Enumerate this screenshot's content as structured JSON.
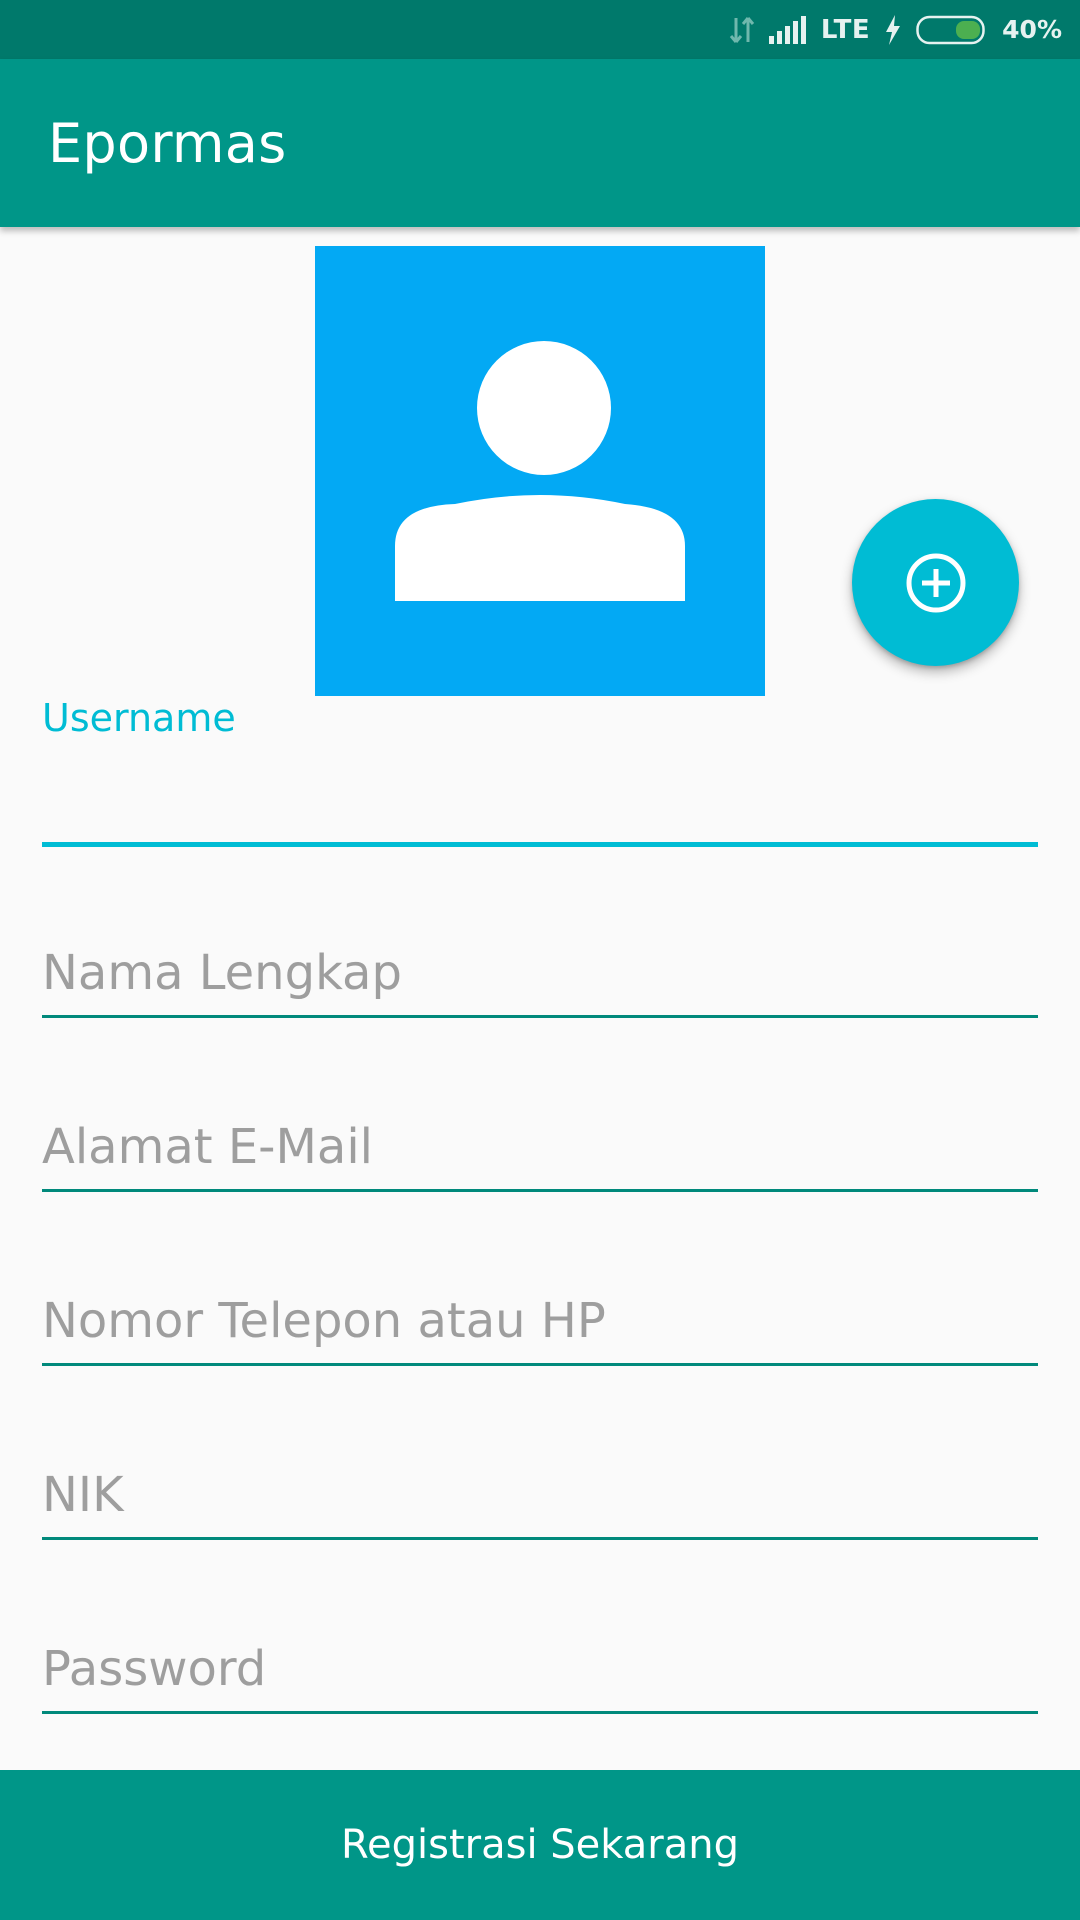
{
  "status_bar": {
    "network": "LTE",
    "battery_percent": "40%",
    "battery_level": 0.4,
    "icons": [
      "data-activity-icon",
      "signal-icon",
      "charging-bolt-icon",
      "battery-icon"
    ]
  },
  "app_bar": {
    "title": "Epormas"
  },
  "avatar": {
    "icon": "person-icon",
    "background_color": "#03a9f4"
  },
  "fab": {
    "icon": "add-circle-icon",
    "color": "#00bcd4"
  },
  "form": {
    "username": {
      "label": "Username",
      "value": ""
    },
    "full_name": {
      "placeholder": "Nama Lengkap"
    },
    "email": {
      "placeholder": "Alamat E-Mail"
    },
    "phone": {
      "placeholder": "Nomor Telepon atau HP"
    },
    "nik": {
      "placeholder": "NIK"
    },
    "password": {
      "placeholder": "Password"
    }
  },
  "register_button": {
    "label": "Registrasi Sekarang"
  },
  "colors": {
    "status_bar": "#00796b",
    "primary": "#009688",
    "accent": "#00bcd4",
    "underline": "#00897b",
    "placeholder_text": "#9e9e9e"
  }
}
